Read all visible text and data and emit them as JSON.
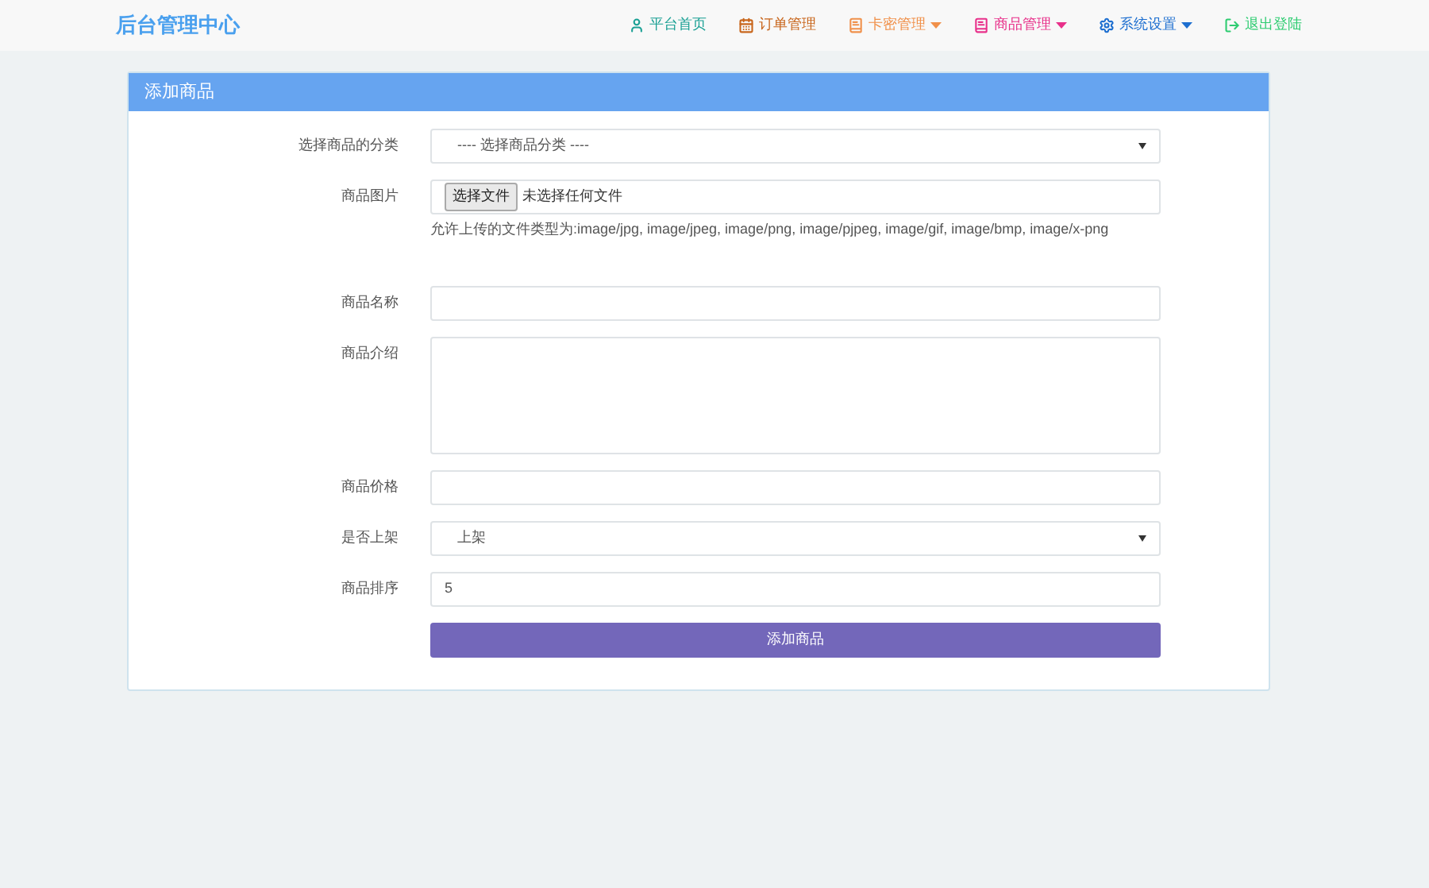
{
  "brand": "后台管理中心",
  "nav": [
    {
      "label": "平台首页",
      "color": "#1aa094",
      "dropdown": false
    },
    {
      "label": "订单管理",
      "color": "#c8651b",
      "dropdown": false
    },
    {
      "label": "卡密管理",
      "color": "#f0904a",
      "dropdown": true
    },
    {
      "label": "商品管理",
      "color": "#e8308a",
      "dropdown": true
    },
    {
      "label": "系统设置",
      "color": "#1e6fd0",
      "dropdown": true
    },
    {
      "label": "退出登陆",
      "color": "#2ecc71",
      "dropdown": false
    }
  ],
  "panel": {
    "title": "添加商品",
    "fields": [
      {
        "kind": "select",
        "label": "选择商品的分类",
        "value": "---- 选择商品分类 ----"
      },
      {
        "kind": "file",
        "label": "商品图片",
        "button": "选择文件",
        "status": "未选择任何文件",
        "hint": "允许上传的文件类型为:image/jpg, image/jpeg, image/png, image/pjpeg, image/gif, image/bmp, image/x-png"
      },
      {
        "kind": "text",
        "label": "商品名称"
      },
      {
        "kind": "textarea",
        "label": "商品介绍"
      },
      {
        "kind": "text",
        "label": "商品价格"
      },
      {
        "kind": "select",
        "label": "是否上架",
        "value": "上架"
      },
      {
        "kind": "text",
        "label": "商品排序",
        "value": "5"
      }
    ],
    "submit": "添加商品"
  }
}
